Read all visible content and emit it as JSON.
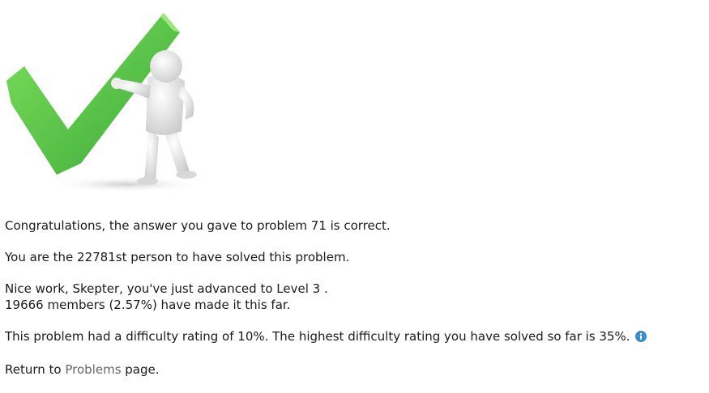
{
  "illustration": {
    "icon": "check-mark-with-figure",
    "check_color": "#4cc24a",
    "check_shade": "#2f8f2c",
    "figure_color": "#f2f2f2"
  },
  "messages": {
    "correct": "Congratulations, the answer you gave to problem 71 is correct.",
    "solver_rank": "You are the 22781st person to have solved this problem.",
    "level_up": "Nice work, Skepter, you've just advanced to Level 3 .",
    "level_stats": "19666 members (2.57%) have made it this far.",
    "difficulty": "This problem had a difficulty rating of 10%. The highest difficulty rating you have solved so far is 35%."
  },
  "return": {
    "prefix": "Return to ",
    "link_label": "Problems",
    "suffix": " page."
  },
  "info_icon": {
    "icon": "info-icon",
    "color": "#3a8fd0"
  }
}
